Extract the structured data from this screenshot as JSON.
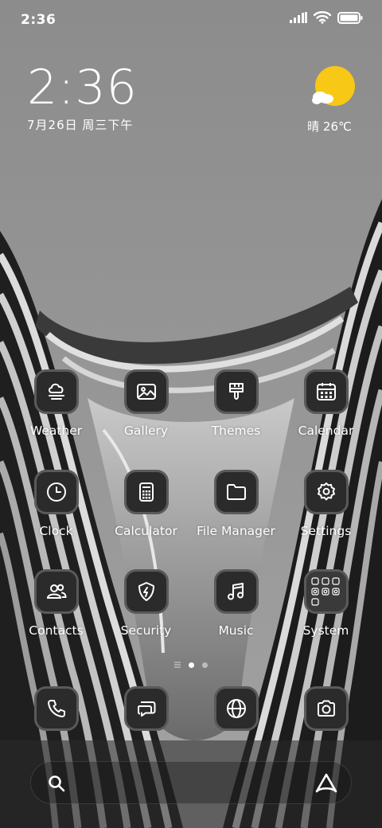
{
  "status_bar": {
    "time": "2:36"
  },
  "clock_widget": {
    "time": "2:36",
    "date": "7月26日 周三下午"
  },
  "weather_widget": {
    "text": "晴 26℃",
    "sun_color": "#F7C815"
  },
  "apps": [
    {
      "label": "Weather",
      "icon": "weather-icon"
    },
    {
      "label": "Gallery",
      "icon": "gallery-icon"
    },
    {
      "label": "Themes",
      "icon": "themes-icon"
    },
    {
      "label": "Calendar",
      "icon": "calendar-icon"
    },
    {
      "label": "Clock",
      "icon": "clock-icon"
    },
    {
      "label": "Calculator",
      "icon": "calculator-icon"
    },
    {
      "label": "File Manager",
      "icon": "folder-icon"
    },
    {
      "label": "Settings",
      "icon": "gear-icon"
    },
    {
      "label": "Contacts",
      "icon": "contacts-icon"
    },
    {
      "label": "Security",
      "icon": "shield-icon"
    },
    {
      "label": "Music",
      "icon": "music-icon"
    },
    {
      "label": "System",
      "icon": "folder-grid-icon"
    }
  ],
  "page_indicator": {
    "current": 2,
    "total": 2
  },
  "dock": [
    {
      "icon": "phone-icon"
    },
    {
      "icon": "messages-icon"
    },
    {
      "icon": "browser-icon"
    },
    {
      "icon": "camera-icon"
    }
  ],
  "search_bar": {
    "left_icon": "search-icon",
    "right_icon": "assistant-icon"
  }
}
